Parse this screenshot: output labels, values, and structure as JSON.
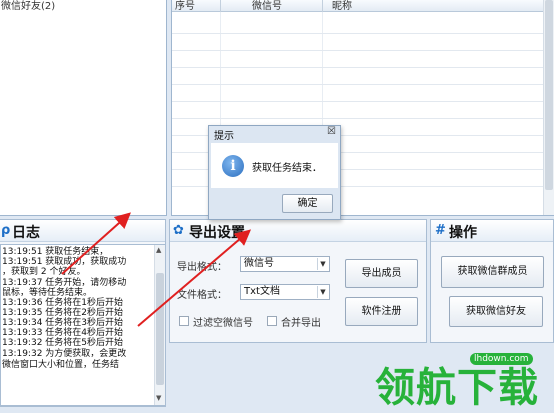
{
  "friends": {
    "node_label": "微信好友(2)"
  },
  "table": {
    "headers": [
      "序号",
      "微信号",
      "昵称"
    ]
  },
  "log_panel": {
    "title": "日志",
    "lines": [
      "13:19:51   获取任务结束，",
      "13:19:51   获取成功，获取成功",
      "，获取到 2 个好友。",
      "13:19:37   任务开始，请勿移动",
      "鼠标，等待任务结束。",
      "13:19:36   任务将在1秒后开始",
      "13:19:35   任务将在2秒后开始",
      "13:19:34   任务将在3秒后开始",
      "13:19:33   任务将在4秒后开始",
      "13:19:32   任务将在5秒后开始",
      "13:19:32   为方便获取，会更改",
      "微信窗口大小和位置，任务结"
    ]
  },
  "export_panel": {
    "title": "导出设置",
    "format_label": "导出格式：",
    "format_value": "微信号",
    "file_label": "文件格式：",
    "file_value": "Txt文档",
    "filter_label": "过滤空微信号",
    "merge_label": "合并导出",
    "export_members_btn": "导出成员",
    "register_btn": "软件注册"
  },
  "ops_panel": {
    "title": "操作",
    "get_group_btn": "获取微信群成员",
    "get_friends_btn": "获取微信好友"
  },
  "dialog": {
    "title": "提示",
    "close": "☒",
    "message": "获取任务结束．",
    "ok_btn": "确定"
  },
  "watermark": {
    "text": "领航下载",
    "site": "lhdown.com"
  },
  "colors": {
    "accent": "#1e6fc7",
    "arrow": "#e02020",
    "watermark": "#27b23a"
  }
}
